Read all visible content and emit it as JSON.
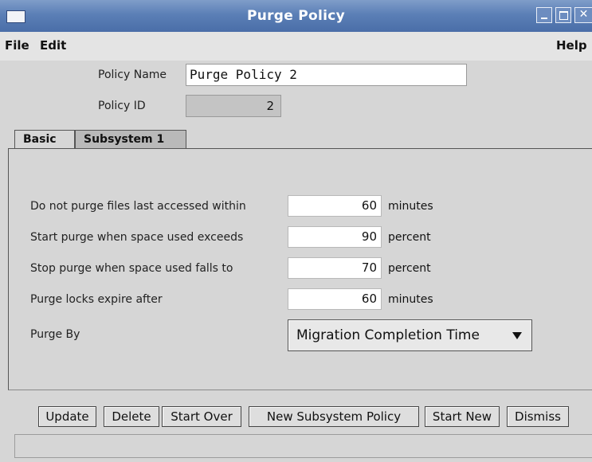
{
  "window": {
    "title": "Purge Policy"
  },
  "menu": {
    "file": "File",
    "edit": "Edit",
    "help": "Help"
  },
  "policy": {
    "name_label": "Policy Name",
    "name_value": "Purge Policy 2",
    "id_label": "Policy ID",
    "id_value": "2"
  },
  "tabs": [
    {
      "label": "Basic",
      "selected": true
    },
    {
      "label": "Subsystem 1",
      "selected": false
    }
  ],
  "basic": {
    "rows": [
      {
        "label": "Do not purge files last accessed within",
        "value": "60",
        "unit": "minutes"
      },
      {
        "label": "Start purge when space used exceeds",
        "value": "90",
        "unit": "percent"
      },
      {
        "label": "Stop purge when space used falls to",
        "value": "70",
        "unit": "percent"
      },
      {
        "label": "Purge locks expire after",
        "value": "60",
        "unit": "minutes"
      }
    ],
    "purge_by_label": "Purge By",
    "purge_by_value": "Migration Completion Time"
  },
  "buttons": {
    "update": "Update",
    "delete": "Delete",
    "start_over": "Start Over",
    "new_subsystem_policy": "New Subsystem Policy",
    "start_new": "Start New",
    "dismiss": "Dismiss"
  },
  "status": {
    "text": ""
  }
}
